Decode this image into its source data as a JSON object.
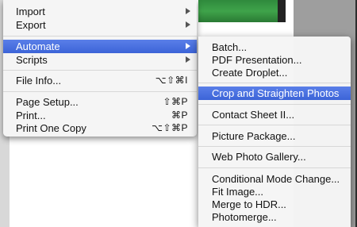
{
  "main_menu": {
    "items": [
      {
        "label": "Import",
        "has_submenu": true
      },
      {
        "label": "Export",
        "has_submenu": true
      },
      {
        "label": "Automate",
        "has_submenu": true,
        "highlighted": true
      },
      {
        "label": "Scripts",
        "has_submenu": true
      },
      {
        "label": "File Info...",
        "shortcut": "⌥⇧⌘I"
      },
      {
        "label": "Page Setup...",
        "shortcut": "⇧⌘P"
      },
      {
        "label": "Print...",
        "shortcut": "⌘P"
      },
      {
        "label": "Print One Copy",
        "shortcut": "⌥⇧⌘P"
      }
    ]
  },
  "automate_submenu": {
    "items": [
      {
        "label": "Batch..."
      },
      {
        "label": "PDF Presentation..."
      },
      {
        "label": "Create Droplet..."
      },
      {
        "label": "Crop and Straighten Photos",
        "highlighted": true
      },
      {
        "label": "Contact Sheet II..."
      },
      {
        "label": "Picture Package..."
      },
      {
        "label": "Web Photo Gallery..."
      },
      {
        "label": "Conditional Mode Change..."
      },
      {
        "label": "Fit Image..."
      },
      {
        "label": "Merge to HDR..."
      },
      {
        "label": "Photomerge..."
      }
    ]
  },
  "colors": {
    "highlight": "#3c64d8",
    "menu_bg": "#f5f5f5",
    "photo_green": "#3fa34a"
  }
}
